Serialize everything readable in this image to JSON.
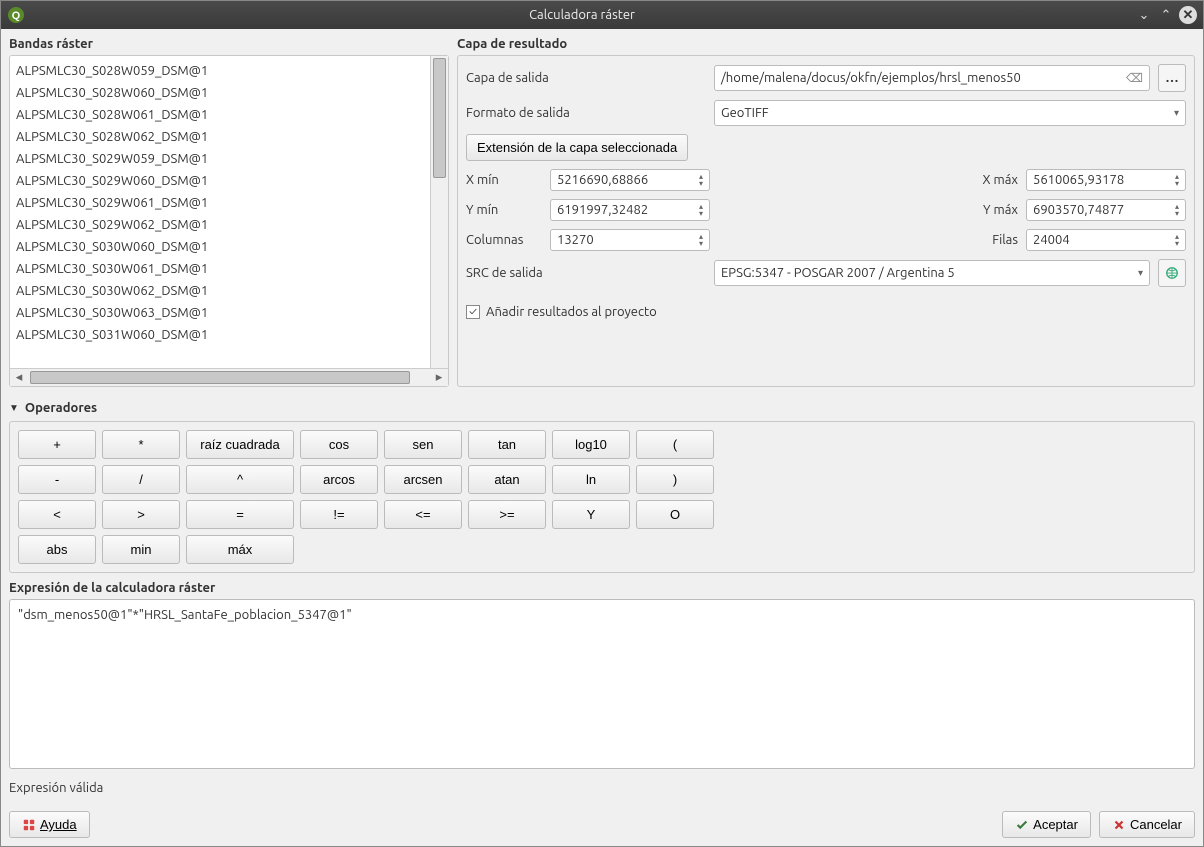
{
  "window": {
    "title": "Calculadora ráster"
  },
  "bands": {
    "heading": "Bandas ráster",
    "items": [
      "ALPSMLC30_S028W059_DSM@1",
      "ALPSMLC30_S028W060_DSM@1",
      "ALPSMLC30_S028W061_DSM@1",
      "ALPSMLC30_S028W062_DSM@1",
      "ALPSMLC30_S029W059_DSM@1",
      "ALPSMLC30_S029W060_DSM@1",
      "ALPSMLC30_S029W061_DSM@1",
      "ALPSMLC30_S029W062_DSM@1",
      "ALPSMLC30_S030W060_DSM@1",
      "ALPSMLC30_S030W061_DSM@1",
      "ALPSMLC30_S030W062_DSM@1",
      "ALPSMLC30_S030W063_DSM@1",
      "ALPSMLC30_S031W060_DSM@1"
    ]
  },
  "result": {
    "heading": "Capa de resultado",
    "output_layer_label": "Capa de salida",
    "output_layer_value": "/home/malena/docus/okfn/ejemplos/hrsl_menos50",
    "output_format_label": "Formato de salida",
    "output_format_value": "GeoTIFF",
    "extent_button": "Extensión de la capa seleccionada",
    "xmin_label": "X mín",
    "xmin_value": "5216690,68866",
    "xmax_label": "X máx",
    "xmax_value": "5610065,93178",
    "ymin_label": "Y mín",
    "ymin_value": "6191997,32482",
    "ymax_label": "Y máx",
    "ymax_value": "6903570,74877",
    "cols_label": "Columnas",
    "cols_value": "13270",
    "rows_label": "Filas",
    "rows_value": "24004",
    "crs_label": "SRC de salida",
    "crs_value": "EPSG:5347 - POSGAR 2007 / Argentina 5",
    "add_to_project_label": "Añadir resultados al proyecto",
    "add_to_project_checked": true
  },
  "operators": {
    "heading": "Operadores",
    "row1": [
      "+",
      "*",
      "raíz cuadrada",
      "cos",
      "sen",
      "tan",
      "log10",
      "("
    ],
    "row2": [
      "-",
      "/",
      "^",
      "arcos",
      "arcsen",
      "atan",
      "ln",
      ")"
    ],
    "row3": [
      "<",
      ">",
      "=",
      "!=",
      "<=",
      ">=",
      "Y",
      "O"
    ],
    "row4": [
      "abs",
      "min",
      "máx"
    ]
  },
  "expression": {
    "heading": "Expresión de la calculadora ráster",
    "value": "\"dsm_menos50@1\"*\"HRSL_SantaFe_poblacion_5347@1\"",
    "status": "Expresión válida"
  },
  "footer": {
    "help": "Ayuda",
    "ok": "Aceptar",
    "cancel": "Cancelar"
  }
}
